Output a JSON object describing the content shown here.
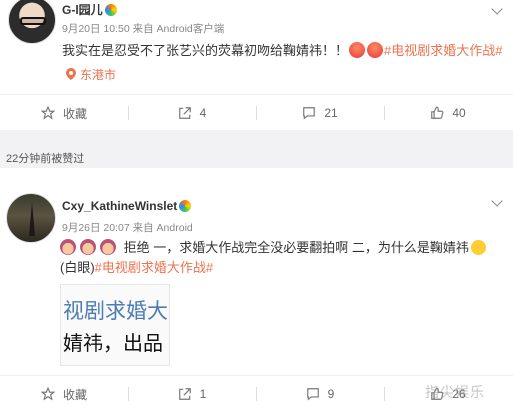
{
  "posts": [
    {
      "username": "G-l园儿",
      "meta": "9月20日 10:50 来自 Android客户端",
      "text": "我实在是忍受不了张艺兴的荧幕初吻给鞠婧祎！！",
      "hashtag": "#电视剧求婚大作战#",
      "location": "东港市",
      "actions": {
        "favorite": "收藏",
        "repost": "4",
        "comment": "21",
        "like": "40"
      }
    },
    {
      "username": "Cxy_KathineWinslet",
      "meta": "9月26日 20:07 来自 Android",
      "line1": "拒绝 一，求婚大作战完全没必要翻拍啊    二，为什么是鞠婧祎",
      "line2_prefix": "(白眼)",
      "hashtag": "#电视剧求婚大作战#",
      "preview_line1": "视剧求婚大",
      "preview_line2": "婧祎，出品",
      "actions": {
        "favorite": "收藏",
        "repost": "1",
        "comment": "9",
        "like": "26"
      }
    }
  ],
  "liked_notice": "22分钟前被赞过",
  "icons": {
    "emoji_angry": "angry-face-emoji",
    "emoji_girl": "no-gesture-girl-emoji",
    "emoji_side": "sideways-look-emoji",
    "location": "location-pin-icon",
    "favorite": "star-icon",
    "repost": "share-icon",
    "comment": "comment-icon",
    "like": "thumbs-up-icon"
  },
  "colors": {
    "hashtag": "#eb7350",
    "background": "#f2f2f5"
  },
  "watermark": "指尖娱乐"
}
